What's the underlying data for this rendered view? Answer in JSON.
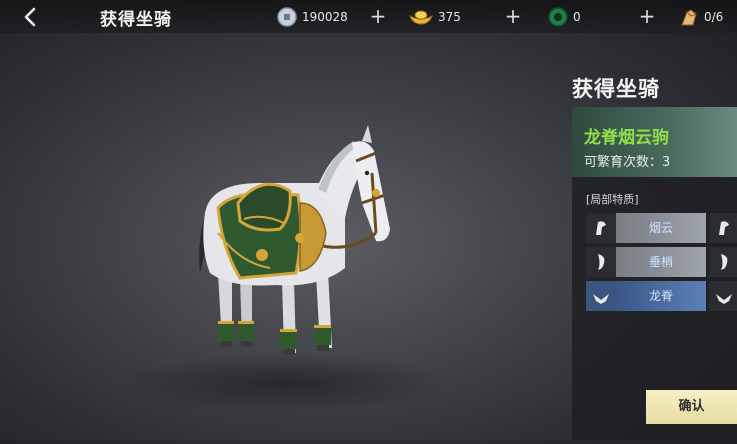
{
  "header": {
    "title": "获得坐骑",
    "currencies": [
      {
        "icon": "silver-coin-icon",
        "value": "190028"
      },
      {
        "icon": "gold-ingot-icon",
        "value": "375"
      },
      {
        "icon": "jade-coin-icon",
        "value": "0"
      },
      {
        "icon": "horse-feed-icon",
        "value": "0/6"
      }
    ]
  },
  "panel": {
    "title": "获得坐骑",
    "mount_name": "龙脊烟云驹",
    "breed_label": "可繁育次数：",
    "breed_count": "3",
    "section_label": "[局部特质]",
    "traits": [
      {
        "label": "烟云",
        "icon": "mane-icon",
        "selected": false
      },
      {
        "label": "垂梢",
        "icon": "tail-icon",
        "selected": false
      },
      {
        "label": "龙脊",
        "icon": "wing-spine-icon",
        "selected": true
      }
    ],
    "confirm_label": "确认"
  },
  "colors": {
    "mount_name": "#8fe04a",
    "selected_trait": "#3d5c8f",
    "confirm_bg": "#f2eab8"
  }
}
